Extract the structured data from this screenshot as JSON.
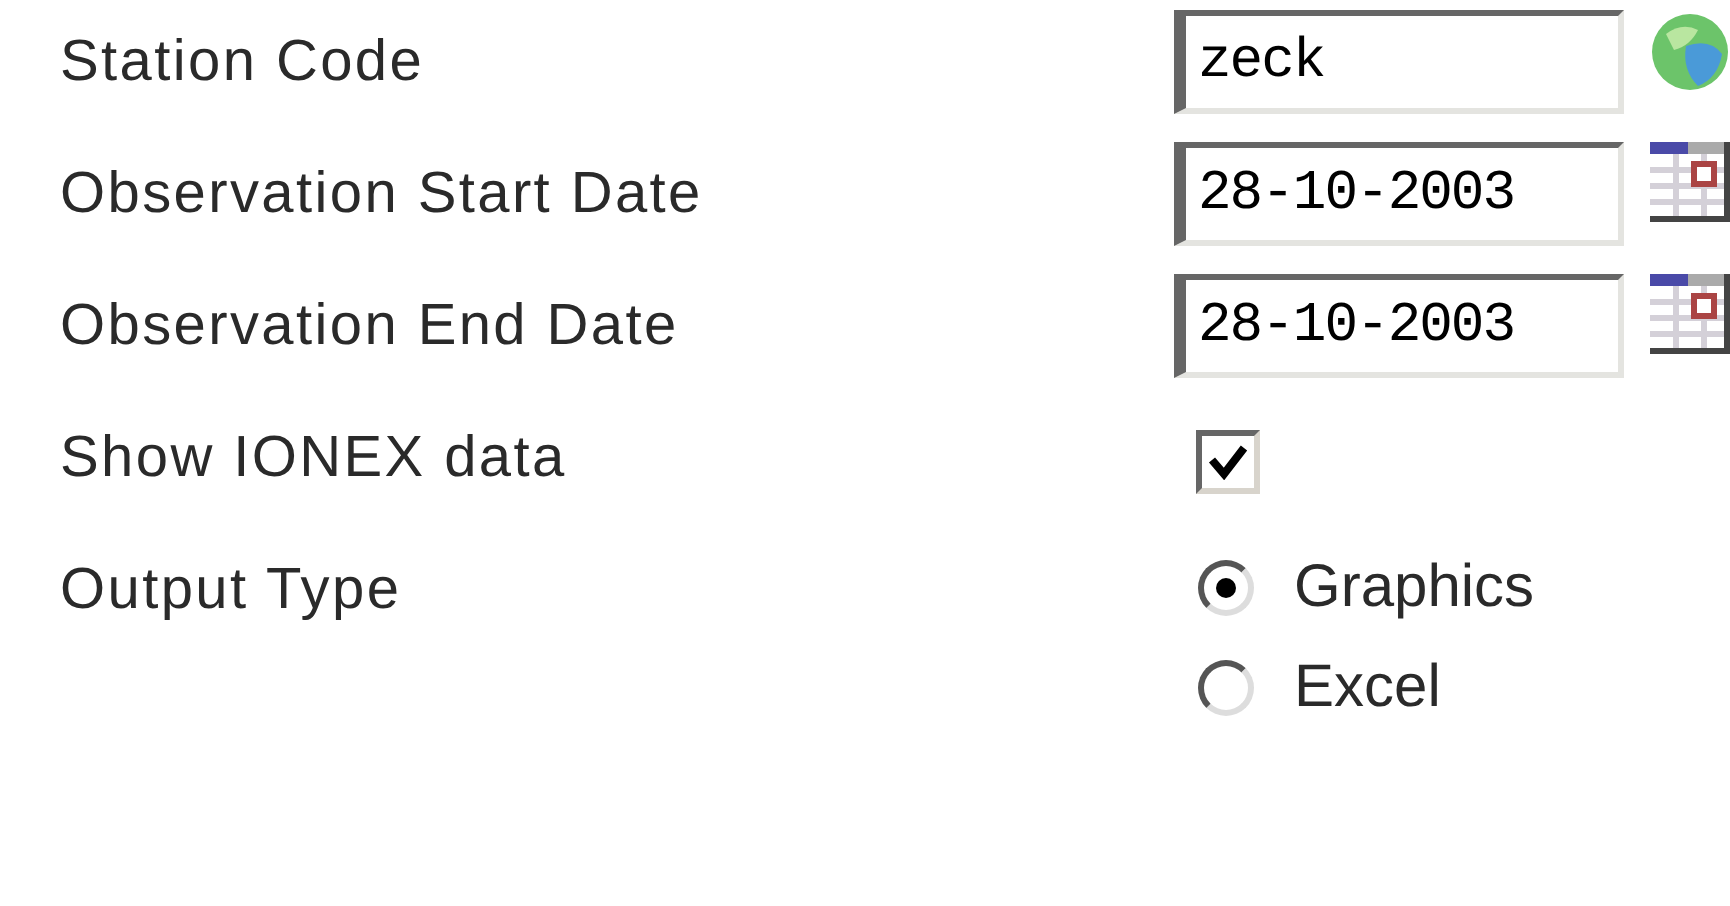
{
  "fields": [
    {
      "kind": "text",
      "label": "Station Code",
      "value": "zeck"
    },
    {
      "kind": "date",
      "label": "Observation Start Date",
      "value": "28-10-2003"
    },
    {
      "kind": "date",
      "label": "Observation End Date",
      "value": "28-10-2003"
    },
    {
      "kind": "checkbox",
      "label": "Show IONEX data",
      "checked": true
    },
    {
      "kind": "radio",
      "label": "Output Type",
      "options": [
        {
          "label": "Graphics",
          "selected": true
        },
        {
          "label": "Excel",
          "selected": false
        }
      ]
    }
  ]
}
